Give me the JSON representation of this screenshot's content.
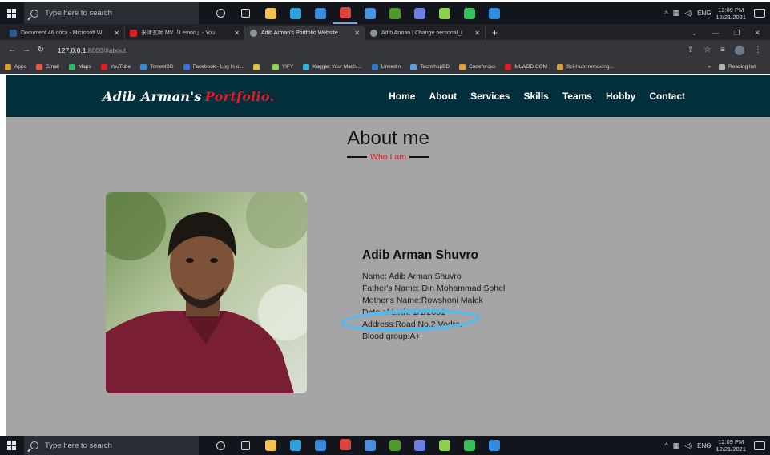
{
  "taskbar": {
    "search_placeholder": "Type here to search",
    "language": "ENG",
    "time": "12:09 PM",
    "date": "12/21/2021",
    "apps": [
      {
        "name": "cortana-icon",
        "color": "#1e1e1e"
      },
      {
        "name": "task-view-icon",
        "color": "#1e1e1e"
      },
      {
        "name": "file-explorer-icon",
        "color": "#f2c14e"
      },
      {
        "name": "edge-icon",
        "color": "#2fa0d8"
      },
      {
        "name": "store-icon",
        "color": "#3b8ad9"
      },
      {
        "name": "chrome-icon",
        "color": "#d9453b"
      },
      {
        "name": "todo-icon",
        "color": "#4b8fe0"
      },
      {
        "name": "xbox-icon",
        "color": "#4c9a2a"
      },
      {
        "name": "photos-icon",
        "color": "#6f7fe0"
      },
      {
        "name": "pycharm-icon",
        "color": "#8fd14f"
      },
      {
        "name": "circle-app-icon",
        "color": "#35c25b"
      },
      {
        "name": "vscode-icon",
        "color": "#2f8de0"
      }
    ]
  },
  "browser": {
    "tabs": [
      {
        "title": "Document 46.docx - Microsoft W",
        "color": "#2b5797"
      },
      {
        "title": "米津玄師 MV「Lemon」- You",
        "color": "#e31b23"
      },
      {
        "title": "Adib Arman's Portfolio Website",
        "color": "#8c9198"
      },
      {
        "title": "Adib Arman | Change personal_i",
        "color": "#8c9198"
      }
    ],
    "url_host": "127.0.0.1",
    "url_path": ":8000/#about",
    "bookmarks": [
      {
        "label": "Apps",
        "color": "#d9a03b"
      },
      {
        "label": "Gmail",
        "color": "#e05a4a"
      },
      {
        "label": "Maps",
        "color": "#3bb36a"
      },
      {
        "label": "YouTube",
        "color": "#e31b23"
      },
      {
        "label": "TorrentBD",
        "color": "#3b8ad9"
      },
      {
        "label": "Facebook - Log In o...",
        "color": "#3b6fd9"
      },
      {
        "label": "",
        "color": "#d9c43b"
      },
      {
        "label": "YIFY",
        "color": "#8fd14f"
      },
      {
        "label": "Kaggle: Your Machi...",
        "color": "#3bb3e0"
      },
      {
        "label": "LinkedIn",
        "color": "#2f7bc2"
      },
      {
        "label": "TechshopBD",
        "color": "#5aa0e0"
      },
      {
        "label": "Codeforces",
        "color": "#e0a03b"
      },
      {
        "label": "MLWBD.COM",
        "color": "#e31b23"
      },
      {
        "label": "Sci-Hub: removing...",
        "color": "#d9a03b"
      }
    ],
    "reading_list": "Reading list"
  },
  "site": {
    "logo": "Adib Arman's",
    "logo_accent": "Portfolio.",
    "nav": [
      "Home",
      "About",
      "Services",
      "Skills",
      "Teams",
      "Hobby",
      "Contact"
    ],
    "about_title": "About me",
    "about_subtitle": "Who I am",
    "person_name": "Adib Arman Shuvro",
    "details": [
      "Name: Adib Arman Shuvro",
      "Father's Name: Din Mohammad Sohel",
      "Mother's Name:Rowshoni Malek",
      "Date of birth: 1/1/2001",
      "Address:Road No.2 Vodra.",
      "Blood group:A+"
    ]
  }
}
